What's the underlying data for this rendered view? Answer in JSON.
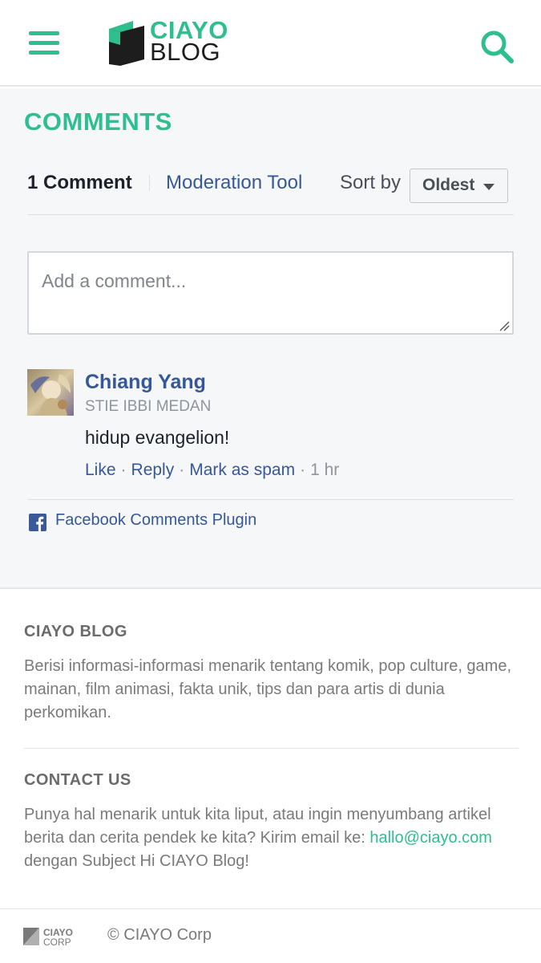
{
  "header": {
    "logo_line1": "CIAYO",
    "logo_line2": "BLOG",
    "brand_color": "#2fbf8f",
    "menu_icon": "hamburger-menu-icon",
    "search_icon": "search-icon"
  },
  "comments": {
    "title": "COMMENTS",
    "count_label": "1 Comment",
    "moderation_label": "Moderation Tool",
    "sort_label": "Sort by",
    "sort_value": "Oldest",
    "input_placeholder": "Add a comment...",
    "items": [
      {
        "author": "Chiang Yang",
        "affiliation": "STIE IBBI MEDAN",
        "text": "hidup evangelion!",
        "actions": {
          "like": "Like",
          "reply": "Reply",
          "spam": "Mark as spam"
        },
        "time": "1 hr"
      }
    ],
    "plugin_label": "Facebook Comments Plugin",
    "link_color": "#365899"
  },
  "footer": {
    "about_heading": "CIAYO BLOG",
    "about_text": "Berisi informasi-informasi menarik tentang komik, pop culture, game, mainan, film animasi, fakta unik, tips dan para artis di dunia perkomikan.",
    "contact_heading": "CONTACT US",
    "contact_text_before": "Punya hal menarik untuk kita liput, atau ingin menyumbang artikel berita dan cerita pendek ke kita? Kirim email ke:",
    "contact_email": "hallo@ciayo.com",
    "contact_text_after": "dengan Subject Hi CIAYO Blog!",
    "corp_logo_line1": "CIAYO",
    "corp_logo_line2": "CORP",
    "copyright": "© CIAYO Corp"
  }
}
